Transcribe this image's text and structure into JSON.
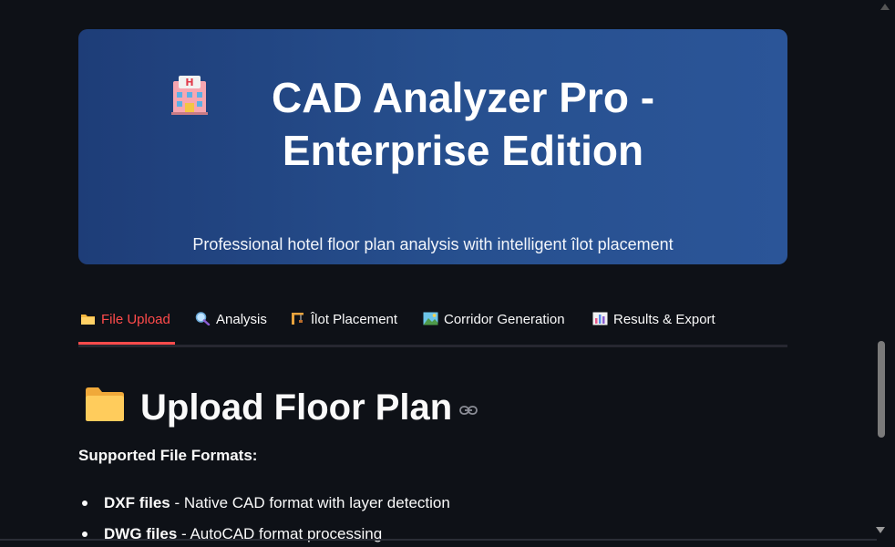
{
  "hero": {
    "title": "CAD Analyzer Pro - Enterprise Edition",
    "subtitle": "Professional hotel floor plan analysis with intelligent îlot placement",
    "icon": "hotel-icon"
  },
  "tabs": [
    {
      "label": "File Upload",
      "icon": "folder-icon",
      "active": true
    },
    {
      "label": "Analysis",
      "icon": "magnifier-icon",
      "active": false
    },
    {
      "label": "Îlot Placement",
      "icon": "construction-icon",
      "active": false
    },
    {
      "label": "Corridor Generation",
      "icon": "landscape-icon",
      "active": false
    },
    {
      "label": "Results & Export",
      "icon": "bar-chart-icon",
      "active": false
    }
  ],
  "section": {
    "title": "Upload Floor Plan",
    "icon": "folder-icon"
  },
  "supported_heading": "Supported File Formats:",
  "formats": [
    {
      "name": "DXF files",
      "desc": " - Native CAD format with layer detection"
    },
    {
      "name": "DWG files",
      "desc": " - AutoCAD format processing"
    }
  ],
  "colors": {
    "background": "#0e1117",
    "hero_gradient_start": "#1e3d78",
    "hero_gradient_end": "#2b5598",
    "accent": "#ff4b4b",
    "text": "#fafafa"
  }
}
